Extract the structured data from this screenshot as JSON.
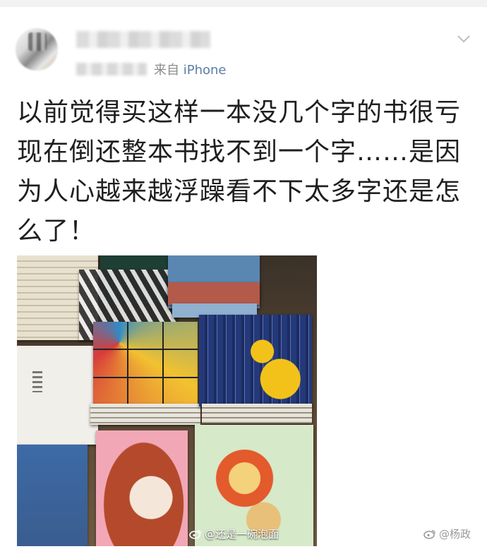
{
  "post": {
    "source_prefix": "来自",
    "source_app": "iPhone",
    "text": "以前觉得买这样一本没几个字的书很亏 现在倒还整本书找不到一个字……是因为人心越来越浮躁看不下太多字还是怎么了！"
  },
  "icons": {
    "menu": "chevron-down-icon",
    "weibo": "weibo-logo-icon"
  },
  "watermarks": {
    "left": "@还是一碗泡面",
    "right": "@杨政"
  },
  "colors": {
    "source_link": "#5b7ea8",
    "meta_gray": "#8a8a8a"
  }
}
